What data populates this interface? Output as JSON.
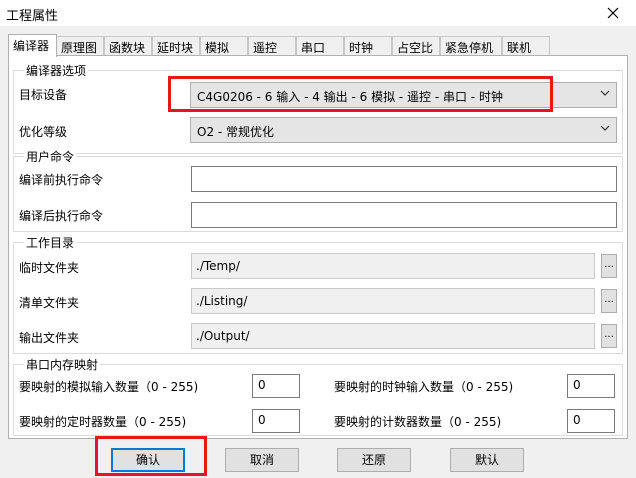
{
  "window": {
    "title": "工程属性"
  },
  "tabs": [
    "编译器",
    "原理图",
    "函数块",
    "延时块",
    "模拟",
    "遥控",
    "串口",
    "时钟",
    "占空比",
    "紧急停机",
    "联机"
  ],
  "compiler_options": {
    "title": "编译器选项",
    "target_label": "目标设备",
    "target_value": "C4G0206 - 6 输入 - 4 输出 - 6 模拟 - 遥控 - 串口 - 时钟",
    "opt_label": "优化等级",
    "opt_value": "O2 - 常规优化"
  },
  "user_commands": {
    "title": "用户命令",
    "pre_label": "编译前执行命令",
    "pre_value": "",
    "post_label": "编译后执行命令",
    "post_value": ""
  },
  "work_dirs": {
    "title": "工作目录",
    "temp_label": "临时文件夹",
    "temp_value": "./Temp/",
    "list_label": "清单文件夹",
    "list_value": "./Listing/",
    "out_label": "输出文件夹",
    "out_value": "./Output/",
    "browse_label": "..."
  },
  "serial_map": {
    "title": "串口内存映射",
    "analog_label": "要映射的模拟输入数量（0 - 255)",
    "analog_value": "0",
    "clock_label": "要映射的时钟输入数量（0 - 255)",
    "clock_value": "0",
    "timer_label": "要映射的定时器数量（0 - 255)",
    "timer_value": "0",
    "counter_label": "要映射的计数器数量（0 - 255)",
    "counter_value": "0"
  },
  "buttons": {
    "ok": "确认",
    "cancel": "取消",
    "restore": "还原",
    "default": "默认"
  },
  "colors": {
    "highlight": "#e8161b",
    "focus": "#0078d7"
  }
}
